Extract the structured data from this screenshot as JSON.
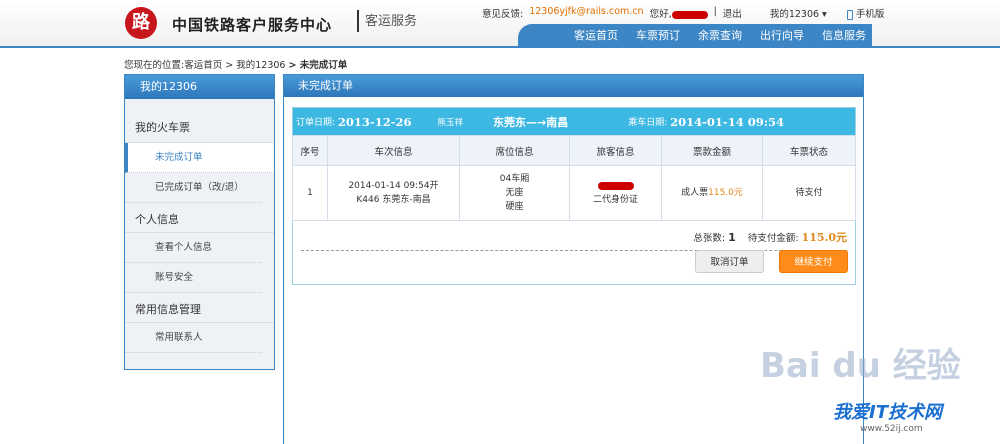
{
  "header": {
    "logo": "路",
    "brand": "中国铁路客户服务中心",
    "sub": "客运服务",
    "feedback_label": "意见反馈:",
    "feedback_email": "12306yjfk@rails.com.cn",
    "greeting": "您好,",
    "sep": "|",
    "logout": "退出",
    "my12306": "我的12306 ▾",
    "mobile": "手机版"
  },
  "nav": [
    "客运首页",
    "车票预订",
    "余票查询",
    "出行向导",
    "信息服务"
  ],
  "breadcrumb": {
    "prefix": "您现在的位置:",
    "items": [
      "客运首页",
      "> 我的12306"
    ],
    "current": "> 未完成订单"
  },
  "sidebar": {
    "title": "我的12306",
    "g1": "我的火车票",
    "i1": "未完成订单",
    "i2": "已完成订单（改/退）",
    "g2": "个人信息",
    "i3": "查看个人信息",
    "i4": "账号安全",
    "g3": "常用信息管理",
    "i5": "常用联系人"
  },
  "main": {
    "title": "未完成订单"
  },
  "order": {
    "date_label": "订单日期:",
    "date": "2013-12-26",
    "name": "熊玉祥",
    "route": "东莞东—→南昌",
    "ride_label": "乘车日期:",
    "ride": "2014-01-14 09:54",
    "headers": [
      "序号",
      "车次信息",
      "席位信息",
      "旅客信息",
      "票款金额",
      "车票状态"
    ],
    "row": {
      "no": "1",
      "train1": "2014-01-14 09:54开",
      "train2": "K446 东莞东-南昌",
      "seat1": "04车厢",
      "seat2": "无座",
      "seat3": "硬座",
      "id": "二代身份证",
      "price_label": "成人票",
      "price": "115.0元",
      "status": "待支付"
    },
    "total_label": "总张数:",
    "total": "1",
    "due_label": "待支付金额:",
    "due": "115.0元",
    "cancel": "取消订单",
    "pay": "继续支付"
  },
  "watermark": {
    "a": "Bai du 经验",
    "b": "我爱IT技术网",
    "c": "www.52ij.com"
  }
}
